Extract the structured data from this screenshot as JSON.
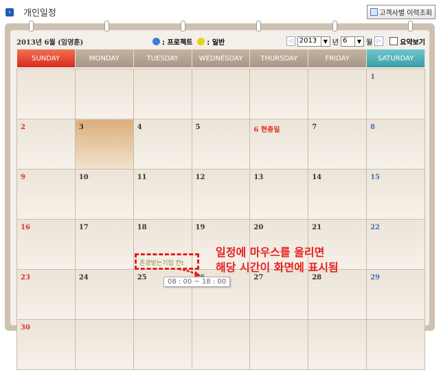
{
  "page": {
    "title": "개인일정",
    "history_button": "고객사별 이력조회"
  },
  "calendar": {
    "month_label": "2013년 6월 (임영훈)",
    "legend": [
      {
        "label": ": 프로젝트",
        "color": "#3a7ed0"
      },
      {
        "label": ": 일반",
        "color": "#e8d020"
      }
    ],
    "year": "2013",
    "year_suffix": "년",
    "month": "6",
    "month_suffix": "월",
    "summary_label": "요약보기",
    "weekdays": [
      "SUNDAY",
      "MONDAY",
      "TUESDAY",
      "WEDNESDAY",
      "THURSDAY",
      "FRIDAY",
      "SATURDAY"
    ],
    "weeks": [
      [
        "",
        "",
        "",
        "",
        "",
        "",
        "1"
      ],
      [
        "2",
        "3",
        "4",
        "5",
        "6 현충일",
        "7",
        "8"
      ],
      [
        "9",
        "10",
        "11",
        "12",
        "13",
        "14",
        "15"
      ],
      [
        "16",
        "17",
        "18",
        "19",
        "20",
        "21",
        "22"
      ],
      [
        "23",
        "24",
        "25",
        "26",
        "27",
        "28",
        "29"
      ],
      [
        "30",
        "",
        "",
        "",
        "",
        "",
        ""
      ]
    ],
    "today": "3",
    "event": {
      "title": "존경받는기업 컨t",
      "time": "08 : 00 ~ 18 : 00"
    },
    "annotation": [
      "일정에 마우스를 올리면",
      "해당 시간이 화면에 표시됨"
    ]
  }
}
